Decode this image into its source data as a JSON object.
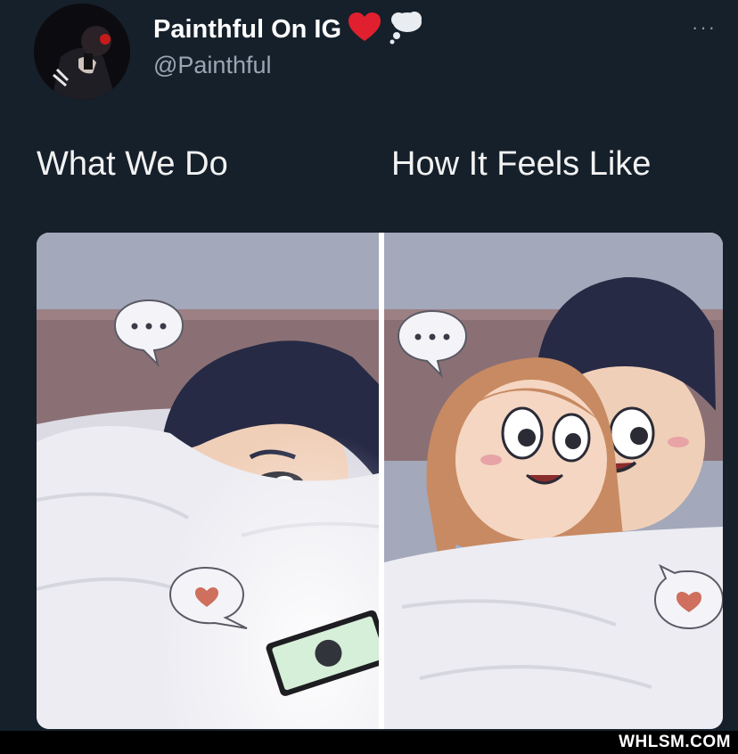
{
  "tweet": {
    "display_name": "Painthful On IG",
    "handle": "@Painthful",
    "more_label": "···",
    "name_icons": [
      "heart-icon",
      "thought-bubble-icon"
    ]
  },
  "captions": {
    "left": "What We Do",
    "right": "How It Feels Like"
  },
  "comic": {
    "left_panel_bubbles": [
      "typing-bubble-icon",
      "heart-bubble-icon"
    ],
    "right_panel_bubbles": [
      "typing-bubble-icon",
      "heart-bubble-icon"
    ],
    "colors": {
      "heart": "#cf6f5e",
      "bg": "#15202b",
      "bed": "#eeeef3",
      "wall": "#a4a9bc"
    }
  },
  "footer": {
    "watermark": "WHLSM.COM"
  }
}
